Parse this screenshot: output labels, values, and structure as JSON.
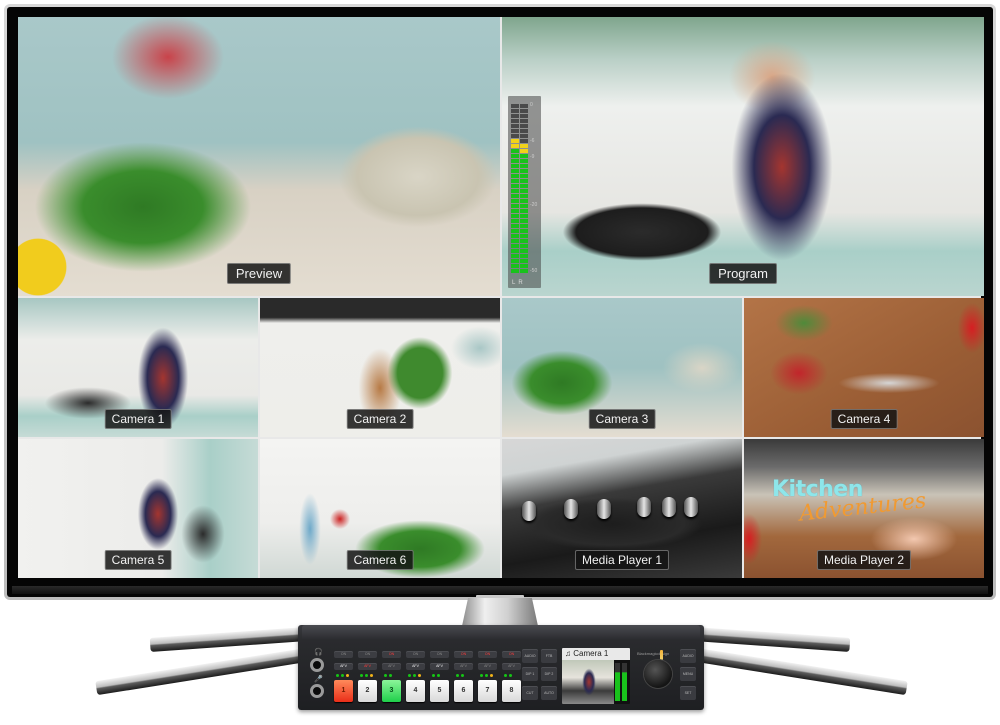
{
  "multiview": {
    "preview": {
      "label": "Preview"
    },
    "program": {
      "label": "Program"
    },
    "sources": [
      {
        "label": "Camera 1",
        "tally": "program"
      },
      {
        "label": "Camera 2",
        "tally": "none"
      },
      {
        "label": "Camera 3",
        "tally": "preview"
      },
      {
        "label": "Camera 4",
        "tally": "none"
      },
      {
        "label": "Camera 5",
        "tally": "none"
      },
      {
        "label": "Camera 6",
        "tally": "none"
      },
      {
        "label": "Media Player 1",
        "tally": "none"
      },
      {
        "label": "Media Player 2",
        "tally": "none"
      }
    ],
    "graphic_title": {
      "line1": "Kitchen",
      "line2": "Adventures"
    },
    "audio_meter": {
      "channels": [
        "L",
        "R"
      ],
      "ticks": [
        "0",
        "-6",
        "-9",
        "-20",
        "-50"
      ],
      "left_level": 0.8,
      "right_level": 0.77
    },
    "tally_colors": {
      "program": "#e0213a",
      "preview": "#1fe01f"
    }
  },
  "switcher": {
    "brand": "Blackmagicdesign",
    "on_buttons": [
      {
        "label": "ON",
        "lit": false
      },
      {
        "label": "ON",
        "lit": false
      },
      {
        "label": "ON",
        "lit": true
      },
      {
        "label": "ON",
        "lit": false
      },
      {
        "label": "ON",
        "lit": false
      },
      {
        "label": "ON",
        "lit": true
      },
      {
        "label": "ON",
        "lit": true
      },
      {
        "label": "ON",
        "lit": true
      }
    ],
    "afv_buttons": [
      {
        "label": "AFV",
        "state": "white"
      },
      {
        "label": "AFV",
        "state": "red"
      },
      {
        "label": "AFV",
        "state": "dim"
      },
      {
        "label": "AFV",
        "state": "white"
      },
      {
        "label": "AFV",
        "state": "white"
      },
      {
        "label": "AFV",
        "state": "dim"
      },
      {
        "label": "AFV",
        "state": "dim"
      },
      {
        "label": "AFV",
        "state": "dim"
      }
    ],
    "source_buttons": [
      {
        "label": "1",
        "state": "program"
      },
      {
        "label": "2",
        "state": "off"
      },
      {
        "label": "3",
        "state": "preview"
      },
      {
        "label": "4",
        "state": "off"
      },
      {
        "label": "5",
        "state": "off"
      },
      {
        "label": "6",
        "state": "off"
      },
      {
        "label": "7",
        "state": "off"
      },
      {
        "label": "8",
        "state": "off"
      }
    ],
    "control_buttons": {
      "audio": "AUDIO MIX",
      "ftb": "FTB",
      "dip1": "DIP 1",
      "dip2": "DIP 2",
      "cut": "CUT",
      "auto": "AUTO",
      "right1": "AUDIO",
      "right2": "MENU",
      "right3": "SET"
    },
    "lcd": {
      "icon": "music-note-icon",
      "source": "Camera 1",
      "icon_glyph": "♫"
    },
    "headphone_icon": "🎧",
    "mic_icon": "🎤"
  }
}
